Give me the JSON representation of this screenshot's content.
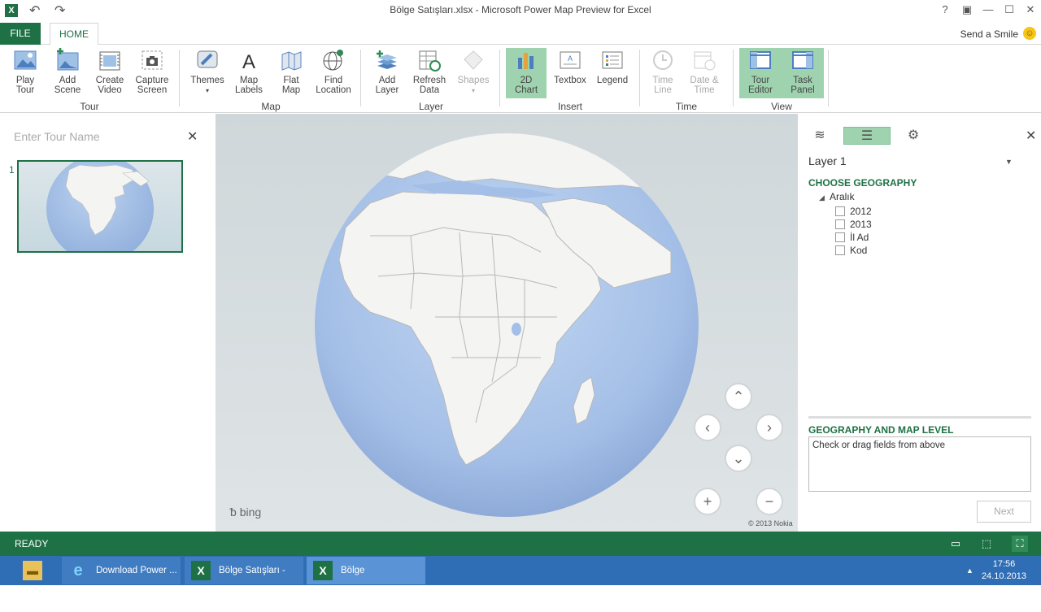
{
  "window": {
    "title": "Bölge Satışları.xlsx - Microsoft Power Map Preview for Excel",
    "app_icon": "X"
  },
  "tabs": {
    "file": "FILE",
    "home": "HOME",
    "send_smile": "Send a Smile"
  },
  "ribbon": {
    "tour": {
      "label": "Tour",
      "play_tour": [
        "Play",
        "Tour"
      ],
      "add_scene": [
        "Add",
        "Scene"
      ],
      "create_video": [
        "Create",
        "Video"
      ],
      "capture_screen": [
        "Capture",
        "Screen"
      ]
    },
    "map": {
      "label": "Map",
      "themes": "Themes",
      "map_labels": [
        "Map",
        "Labels"
      ],
      "flat_map": [
        "Flat",
        "Map"
      ],
      "find_location": [
        "Find",
        "Location"
      ]
    },
    "layer": {
      "label": "Layer",
      "add_layer": [
        "Add",
        "Layer"
      ],
      "refresh_data": [
        "Refresh",
        "Data"
      ],
      "shapes": "Shapes"
    },
    "insert": {
      "label": "Insert",
      "chart_2d": [
        "2D",
        "Chart"
      ],
      "textbox": "Textbox",
      "legend": "Legend"
    },
    "time": {
      "label": "Time",
      "time_line": [
        "Time",
        "Line"
      ],
      "date_time": [
        "Date &",
        "Time"
      ]
    },
    "view": {
      "label": "View",
      "tour_editor": [
        "Tour",
        "Editor"
      ],
      "task_panel": [
        "Task",
        "Panel"
      ]
    }
  },
  "left_panel": {
    "tour_name_placeholder": "Enter Tour Name",
    "scene_number": "1"
  },
  "map": {
    "bing": "bing",
    "copyright": "© 2013 Nokia"
  },
  "right_panel": {
    "layer_name": "Layer 1",
    "choose_geography": "CHOOSE GEOGRAPHY",
    "table_name": "Aralık",
    "fields": [
      "2012",
      "2013",
      "İl Ad",
      "Kod"
    ],
    "geo_level_header": "GEOGRAPHY AND MAP LEVEL",
    "geo_level_hint": "Check or drag fields from above",
    "next": "Next"
  },
  "status": {
    "ready": "READY"
  },
  "taskbar": {
    "items": [
      "Download Power ...",
      "Bölge Satışları - Ex...",
      "Bölge Satışları.xlsx..."
    ],
    "time": "17:56",
    "date": "24.10.2013"
  },
  "colors": {
    "accent": "#1e7145",
    "selected": "#9fd3b0",
    "taskbar": "#2f6db5",
    "globe_ocean": "#a9c3e8",
    "land": "#f4f4f2"
  }
}
